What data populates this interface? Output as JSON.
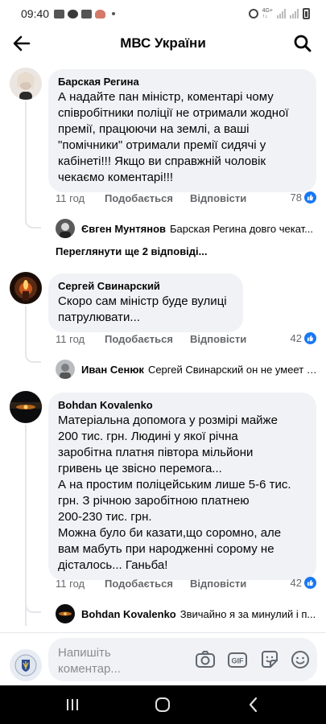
{
  "status_bar": {
    "time": "09:40"
  },
  "header": {
    "title": "МВС України"
  },
  "comments": [
    {
      "author": "Барская Регина",
      "text": "А надайте  пан міністр,  коментарі чому\nспівробітники поліції не отримали жодної\nпремії, працюючи на землі, а ваші\n\"помічники\" отримали премії сидячі у\nкабінеті!!! Якщо ви справжній чоловік\nчекаємо коментарі!!!",
      "time": "11 год",
      "like_label": "Подобається",
      "reply_label": "Відповісти",
      "reactions": "78",
      "reply": {
        "author": "Євген Мунтянов",
        "snippet": "Барская Регина довго чекат..."
      },
      "more_replies": "Переглянути ще 2 відповіді..."
    },
    {
      "author": "Сергей Свинарский",
      "text": "Скоро сам міністр буде вулиці\nпатрулювати...",
      "time": "11 год",
      "like_label": "Подобається",
      "reply_label": "Відповісти",
      "reactions": "42",
      "reply": {
        "author": "Иван Сенюк",
        "snippet": "Сергей Свинарский он не умеет !..."
      }
    },
    {
      "author": "Bohdan Kovalenko",
      "text": "Матеріальна допомога у розмірі майже\n200 тис. грн. Людині у якої річна\nзаробітна платня півтора мільйони\nгривень це звісно перемога...\nА на простим поліцейським лише 5-6 тис.\nгрн. З річною заробітною платнею\n200-230 тис. грн.\nМожна було би казати,що соромно, але\nвам мабуть при народженні сорому не\nдісталось... Ганьба!",
      "time": "11 год",
      "like_label": "Подобається",
      "reply_label": "Відповісти",
      "reactions": "42",
      "reply": {
        "author": "Bohdan Kovalenko",
        "snippet": "Звичайно я за минулий і п..."
      }
    }
  ],
  "composer": {
    "placeholder": "Напишіть коментар..."
  },
  "icons": {
    "back": "arrow-left-icon",
    "search": "search-icon",
    "like_badge": "thumbs-up-icon",
    "camera": "camera-icon",
    "gif": "gif-icon",
    "sticker": "sticker-icon",
    "emoji": "emoji-icon"
  },
  "colors": {
    "accent": "#1877f2",
    "bubble": "#f0f2f5",
    "muted": "#65676b"
  }
}
